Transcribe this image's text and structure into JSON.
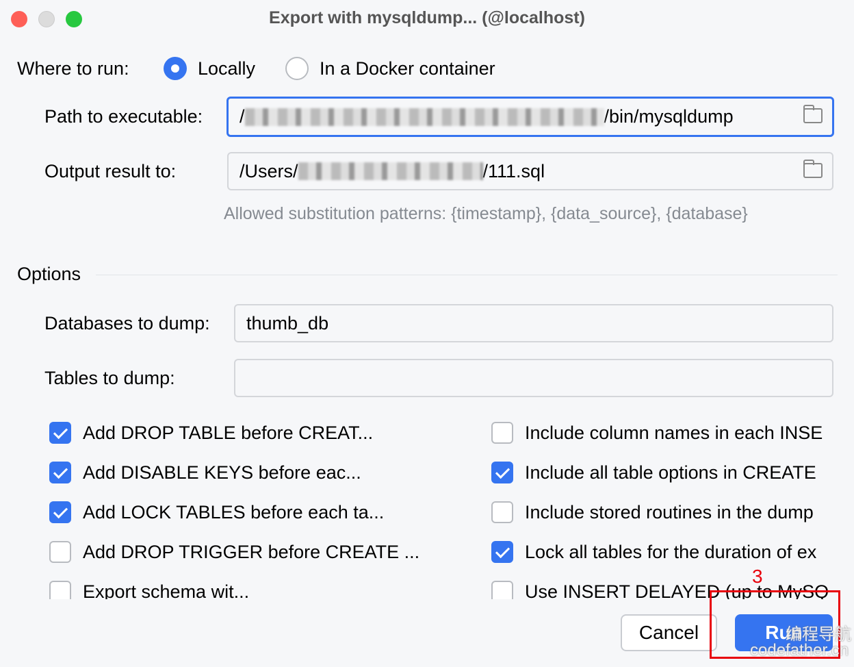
{
  "window": {
    "title": "Export with mysqldump... (@localhost)",
    "traffic_lights": {
      "close": "#fe5f57",
      "minimize": "#dcdcdc",
      "zoom": "#28c840"
    }
  },
  "where_to_run": {
    "label": "Where to run:",
    "options": [
      {
        "label": "Locally",
        "selected": true
      },
      {
        "label": "In a Docker container",
        "selected": false
      }
    ]
  },
  "path": {
    "label": "Path to executable:",
    "prefix": "/",
    "suffix": "/bin/mysqldump",
    "icon": "folder-icon"
  },
  "output": {
    "label": "Output result to:",
    "prefix": "/Users/",
    "suffix": "/111.sql",
    "icon": "folder-icon"
  },
  "hint": "Allowed substitution patterns: {timestamp}, {data_source}, {database}",
  "options": {
    "heading": "Options",
    "databases_label": "Databases to dump:",
    "databases_value": "thumb_db",
    "tables_label": "Tables to dump:",
    "tables_value": ""
  },
  "checkboxes_left": [
    {
      "label": "Add DROP TABLE before CREAT...",
      "checked": true
    },
    {
      "label": "Add DISABLE KEYS before eac...",
      "checked": true
    },
    {
      "label": "Add LOCK TABLES before each ta...",
      "checked": true
    },
    {
      "label": "Add DROP TRIGGER before CREATE ...",
      "checked": false
    },
    {
      "label": "Export schema wit...",
      "checked": false
    }
  ],
  "checkboxes_right": [
    {
      "label": "Include column names in each INSE",
      "checked": false
    },
    {
      "label": "Include all table options in CREATE",
      "checked": true
    },
    {
      "label": "Include stored routines in the dump",
      "checked": false
    },
    {
      "label": "Lock all tables for the duration of ex",
      "checked": true
    },
    {
      "label": "Use INSERT DELAYED (up to MySQ",
      "checked": false
    }
  ],
  "buttons": {
    "cancel": "Cancel",
    "run": "Run"
  },
  "annotation": {
    "number": "3",
    "color": "#e8000b"
  },
  "watermark": {
    "line1": "编程导航",
    "line2": "codefather.cn"
  },
  "accent": "#3574f0"
}
